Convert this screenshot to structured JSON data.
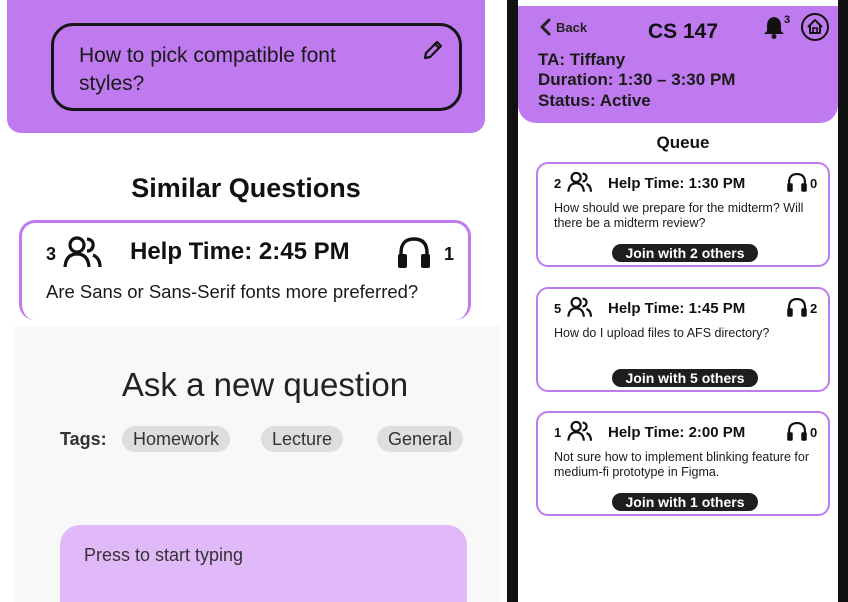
{
  "left": {
    "search_text": "How to pick compatible font styles?",
    "similar_title": "Similar Questions",
    "similar_card": {
      "people_count": "3",
      "help_time": "Help Time: 2:45 PM",
      "ta_count": "1",
      "question": "Are Sans or Sans-Serif fonts more preferred?"
    },
    "ask_title": "Ask a new question",
    "tags_label": "Tags:",
    "tags": [
      "Homework",
      "Lecture",
      "General"
    ],
    "typing_placeholder": "Press to start typing"
  },
  "phone": {
    "back_label": "Back",
    "course": "CS 147",
    "notification_count": "3",
    "ta": "TA: Tiffany",
    "duration": "Duration: 1:30 – 3:30 PM",
    "status": "Status: Active",
    "queue_title": "Queue",
    "cards": [
      {
        "people_count": "2",
        "help_time": "Help Time: 1:30 PM",
        "ta_count": "0",
        "question": "How should we prepare for the midterm? Will there be a midterm review?",
        "join": "Join with 2 others"
      },
      {
        "people_count": "5",
        "help_time": "Help Time: 1:45 PM",
        "ta_count": "2",
        "question": "How do I upload files to AFS directory?",
        "join": "Join with 5 others"
      },
      {
        "people_count": "1",
        "help_time": "Help Time: 2:00 PM",
        "ta_count": "0",
        "question": "Not sure how to implement blinking feature for medium-fi prototype in Figma.",
        "join": "Join with 1 others"
      }
    ]
  },
  "colors": {
    "accent_purple": "#c07aef",
    "light_purple": "#e2b9f8",
    "tag_gray": "#dedede",
    "dark": "#1e1e1e"
  },
  "icons": [
    "pencil-icon",
    "people-icon",
    "headphones-icon",
    "chevron-left-icon",
    "bell-icon",
    "home-icon"
  ]
}
